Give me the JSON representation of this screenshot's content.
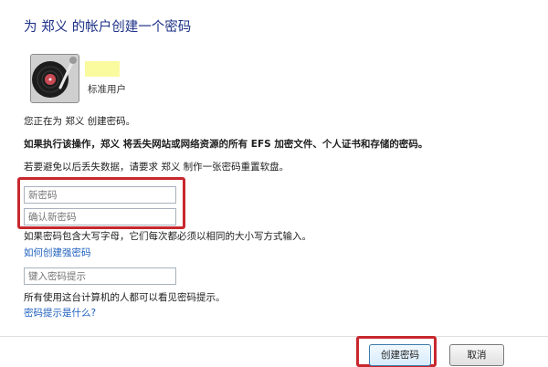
{
  "header": {
    "title": "为 郑义 的帐户创建一个密码"
  },
  "account": {
    "type": "标准用户"
  },
  "messages": {
    "creating": "您正在为 郑义 创建密码。",
    "warning": "如果执行该操作，郑义 将丢失网站或网络资源的所有 EFS 加密文件、个人证书和存储的密码。",
    "reset_tip": "若要避免以后丢失数据，请要求 郑义 制作一张密码重置软盘。",
    "case_note": "如果密码包含大写字母，它们每次都必须以相同的大小写方式输入。",
    "hint_note": "所有使用这台计算机的人都可以看见密码提示。"
  },
  "fields": {
    "new_password_placeholder": "新密码",
    "confirm_password_placeholder": "确认新密码",
    "hint_placeholder": "键入密码提示"
  },
  "links": {
    "strong_password": "如何创建强密码",
    "what_is_hint": "密码提示是什么?"
  },
  "buttons": {
    "create": "创建密码",
    "cancel": "取消"
  },
  "colors": {
    "title": "#1e3287",
    "link": "#1e5fbd",
    "highlight": "#c7282e"
  }
}
